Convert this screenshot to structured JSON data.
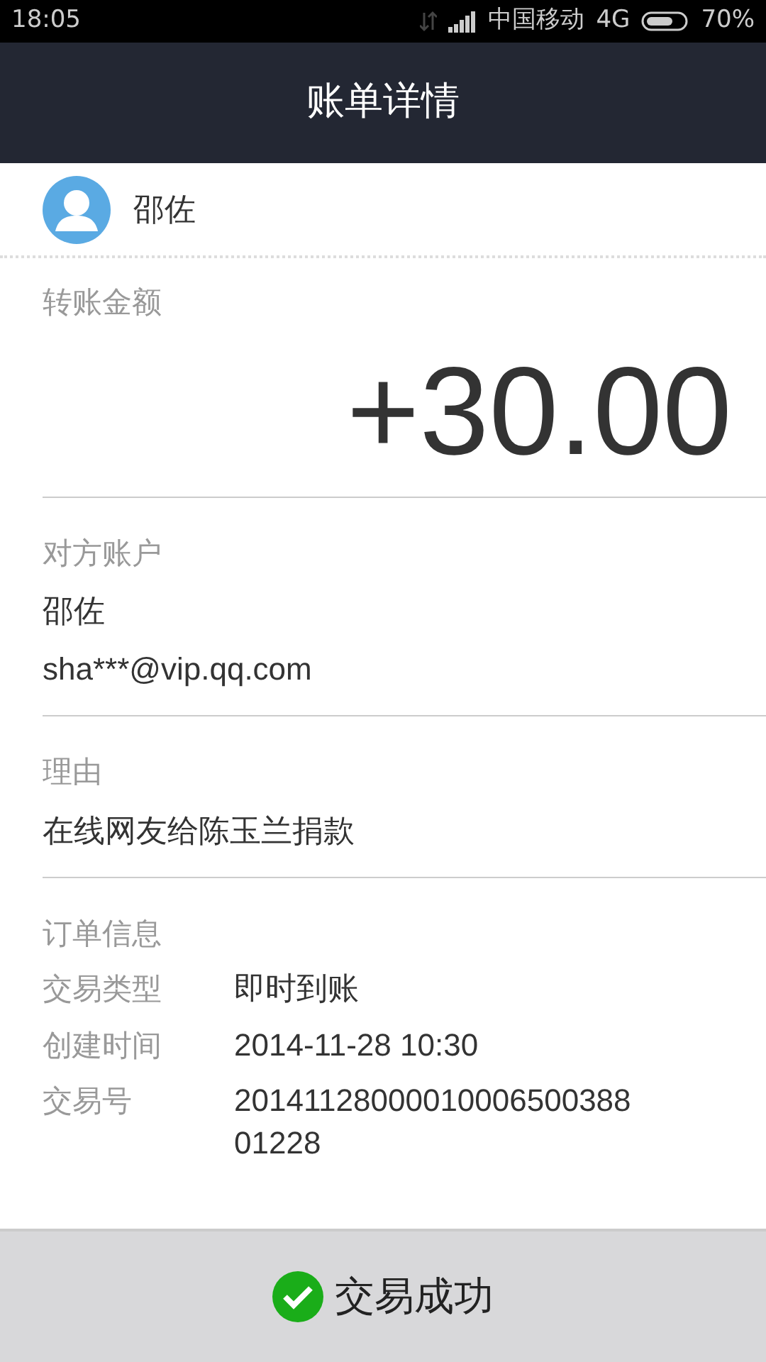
{
  "status_bar": {
    "time": "18:05",
    "carrier": "中国移动",
    "network": "4G",
    "battery": "70%"
  },
  "header": {
    "title": "账单详情"
  },
  "contact": {
    "name": "邵佐"
  },
  "amount": {
    "label": "转账金额",
    "value": "+30.00"
  },
  "counterparty": {
    "label": "对方账户",
    "name": "邵佐",
    "account": "sha***@vip.qq.com"
  },
  "reason": {
    "label": "理由",
    "text": "在线网友给陈玉兰捐款"
  },
  "order": {
    "label": "订单信息",
    "rows": [
      {
        "label": "交易类型",
        "value": "即时到账"
      },
      {
        "label": "创建时间",
        "value": "2014-11-28 10:30"
      },
      {
        "label": "交易号",
        "value": "2014112800001000650038801228"
      }
    ]
  },
  "footer": {
    "status": "交易成功",
    "success": true
  }
}
